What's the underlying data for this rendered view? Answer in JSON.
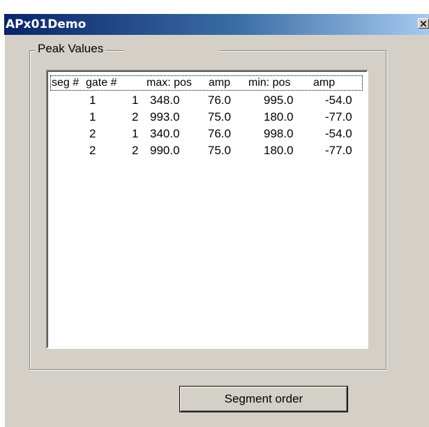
{
  "window": {
    "title": "APx01Demo",
    "close_icon": "close-icon"
  },
  "group": {
    "label": "Peak Values"
  },
  "table": {
    "headers": [
      "seg #",
      "gate #",
      "max: pos",
      "amp",
      "min: pos",
      "amp"
    ],
    "rows": [
      [
        "1",
        "1",
        "348.0",
        "76.0",
        "995.0",
        "-54.0"
      ],
      [
        "1",
        "2",
        "993.0",
        "75.0",
        "180.0",
        "-77.0"
      ],
      [
        "2",
        "1",
        "340.0",
        "76.0",
        "998.0",
        "-54.0"
      ],
      [
        "2",
        "2",
        "990.0",
        "75.0",
        "180.0",
        "-77.0"
      ]
    ]
  },
  "buttons": {
    "segment_order": "Segment order"
  }
}
